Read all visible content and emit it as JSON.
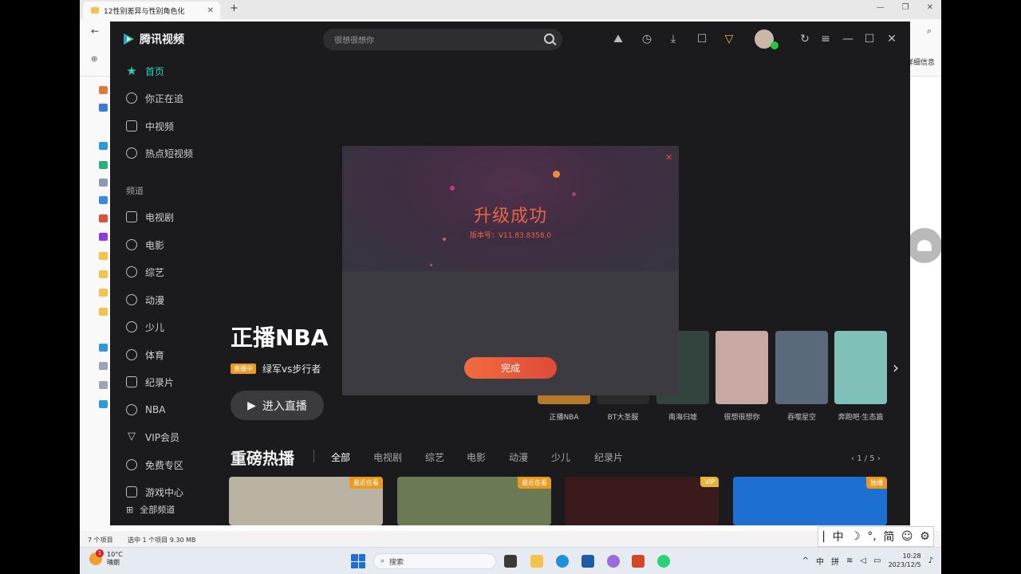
{
  "explorer": {
    "tab_title": "12性别差异与性别角色化",
    "new_tab": "+",
    "cmd_right_text": "详细信息",
    "status_items": "7 个项目",
    "status_selected": "选中 1 个项目  9.30 MB"
  },
  "taskbar": {
    "weather_temp": "10°C",
    "weather_desc": "晴朗",
    "weather_badge": "1",
    "search_label": "搜索",
    "time": "10:28",
    "date": "2023/12/5",
    "tray_lang": "中",
    "tray_ime": "拼"
  },
  "ime_bar": {
    "items": [
      "中",
      "☽",
      "°,",
      "简",
      "☺",
      "⚙"
    ]
  },
  "tencent_video": {
    "app_name": "腾讯视频",
    "search_placeholder": "很想很想你",
    "sidebar": {
      "items": [
        {
          "label": "首页",
          "active": true
        },
        {
          "label": "你正在追"
        },
        {
          "label": "中视频"
        },
        {
          "label": "热点短视频"
        }
      ],
      "section_label": "频道",
      "channels": [
        {
          "label": "电视剧"
        },
        {
          "label": "电影"
        },
        {
          "label": "综艺"
        },
        {
          "label": "动漫"
        },
        {
          "label": "少儿"
        },
        {
          "label": "体育"
        },
        {
          "label": "纪录片"
        },
        {
          "label": "NBA"
        },
        {
          "label": "VIP会员"
        },
        {
          "label": "免费专区"
        },
        {
          "label": "游戏中心"
        }
      ],
      "all_channels": "全部频道"
    },
    "hero": {
      "title": "正播NBA",
      "live_badge": "直播中",
      "live_text": "绿军vs步行者",
      "cta": "进入直播"
    },
    "thumbs": [
      {
        "label": "正播NBA",
        "color": "#b47a2a"
      },
      {
        "label": "BT大圣服",
        "color": "#2a2a2a"
      },
      {
        "label": "南海归墟",
        "color": "#33443f"
      },
      {
        "label": "很想很想你",
        "color": "#c8a9a4"
      },
      {
        "label": "吞噬星空",
        "color": "#5a6a7a"
      },
      {
        "label": "奔跑吧·生态篇",
        "color": "#7fc1b9"
      }
    ],
    "section": {
      "title": "重磅热播",
      "tabs": [
        "全部",
        "电视剧",
        "综艺",
        "电影",
        "动漫",
        "少儿",
        "纪录片"
      ],
      "pager": "1 / 5",
      "cards": [
        {
          "badge": "最近在看",
          "badge_color": "#e99a1f",
          "color": "#b9b3a3"
        },
        {
          "badge": "最近在看",
          "badge_color": "#e99a1f",
          "color": "#6b7a52"
        },
        {
          "badge": "VIP",
          "badge_color": "#e9b23a",
          "color": "#3a1a1a"
        },
        {
          "badge": "独播",
          "badge_color": "#e99a1f",
          "color": "#1d6fd1"
        }
      ]
    },
    "dialog": {
      "title": "升级成功",
      "version": "版本号：V11.83.8358.0",
      "button": "完成"
    }
  },
  "colors": {
    "accent": "#2ad2b4",
    "dialog_accent": "#e86444",
    "app_bg": "#1b1b1d"
  }
}
